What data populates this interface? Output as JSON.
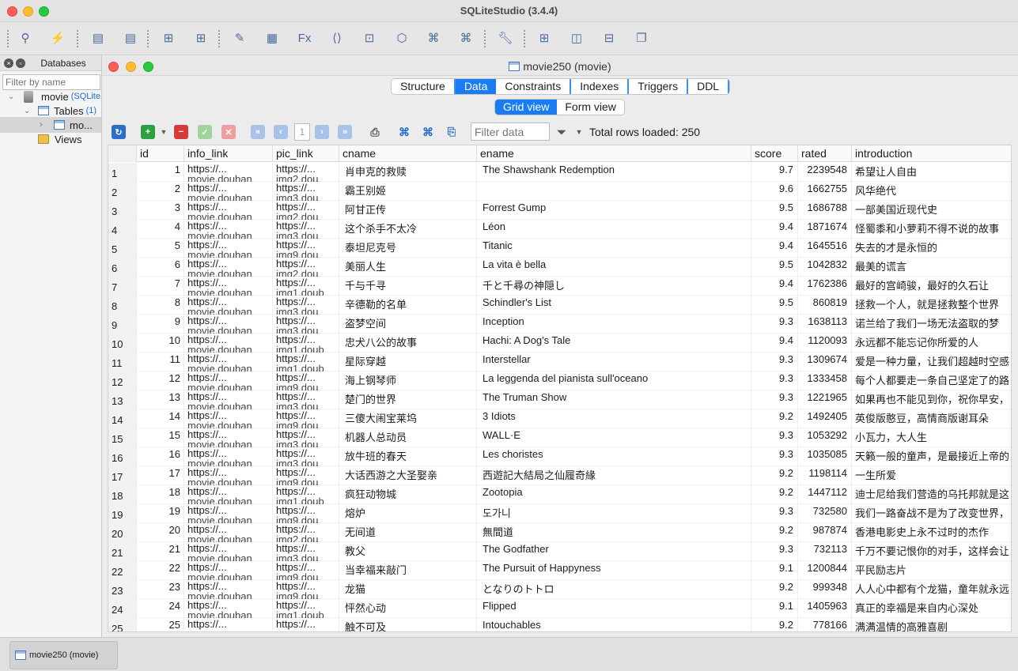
{
  "app": {
    "title": "SQLiteStudio (3.4.4)"
  },
  "toolbar": {
    "icons": [
      "connect-db-icon",
      "disconnect-db-icon",
      "add-database-icon",
      "edit-database-icon",
      "create-table-icon",
      "edit-table-icon",
      "open-sql-editor-icon",
      "sql-functions-icon",
      "ddl-history-icon",
      "collations-icon",
      "extensions-icon",
      "import-icon",
      "export-icon",
      "preferences-icon",
      "tile-windows-icon",
      "tile-horizontal-icon",
      "tile-vertical-icon",
      "cascade-windows-icon"
    ]
  },
  "databases_panel": {
    "title": "Databases",
    "filter_placeholder": "Filter by name",
    "db_name": "movie",
    "db_type": "(SQLite",
    "tables_label": "Tables",
    "tables_count": "(1)",
    "table_item": "mo...",
    "views_label": "Views"
  },
  "window": {
    "title": "movie250 (movie)",
    "tabs": [
      "Structure",
      "Data",
      "Constraints",
      "Indexes",
      "Triggers",
      "DDL"
    ],
    "active_tab": "Data",
    "views": [
      "Grid view",
      "Form view"
    ],
    "active_view": "Grid view"
  },
  "grid_toolbar": {
    "page": "1",
    "filter_placeholder": "Filter data",
    "rows_loaded": "Total rows loaded: 250"
  },
  "grid": {
    "columns": [
      "id",
      "info_link",
      "pic_link",
      "cname",
      "ename",
      "score",
      "rated",
      "introduction"
    ],
    "rows": [
      {
        "n": "1",
        "id": "1",
        "info": "https://...",
        "info2": "movie.douban",
        "pic": "https://...",
        "pic2": "img2.dou",
        "cname": "肖申克的救赎",
        "ename": "The Shawshank Redemption",
        "score": "9.7",
        "rated": "2239548",
        "intro": "希望让人自由"
      },
      {
        "n": "2",
        "id": "2",
        "info": "https://...",
        "info2": "movie.douban",
        "pic": "https://...",
        "pic2": "img3.dou",
        "cname": "霸王别姬",
        "ename": "",
        "score": "9.6",
        "rated": "1662755",
        "intro": "风华绝代"
      },
      {
        "n": "3",
        "id": "3",
        "info": "https://...",
        "info2": "movie.douban",
        "pic": "https://...",
        "pic2": "img2.dou",
        "cname": "阿甘正传",
        "ename": "Forrest Gump",
        "score": "9.5",
        "rated": "1686788",
        "intro": "一部美国近现代史"
      },
      {
        "n": "4",
        "id": "4",
        "info": "https://...",
        "info2": "movie.douban",
        "pic": "https://...",
        "pic2": "img3.dou",
        "cname": "这个杀手不太冷",
        "ename": "Léon",
        "score": "9.4",
        "rated": "1871674",
        "intro": "怪蜀黍和小萝莉不得不说的故事"
      },
      {
        "n": "5",
        "id": "5",
        "info": "https://...",
        "info2": "movie.douban",
        "pic": "https://...",
        "pic2": "img9.dou",
        "cname": "泰坦尼克号",
        "ename": "Titanic",
        "score": "9.4",
        "rated": "1645516",
        "intro": "失去的才是永恒的"
      },
      {
        "n": "6",
        "id": "6",
        "info": "https://...",
        "info2": "movie.douban",
        "pic": "https://...",
        "pic2": "img2.dou",
        "cname": "美丽人生",
        "ename": "La vita è bella",
        "score": "9.5",
        "rated": "1042832",
        "intro": "最美的谎言"
      },
      {
        "n": "7",
        "id": "7",
        "info": "https://...",
        "info2": "movie.douban",
        "pic": "https://...",
        "pic2": "img1.doub",
        "cname": "千与千寻",
        "ename": "千と千尋の神隠し",
        "score": "9.4",
        "rated": "1762386",
        "intro": "最好的宫崎骏，最好的久石让"
      },
      {
        "n": "8",
        "id": "8",
        "info": "https://...",
        "info2": "movie.douban",
        "pic": "https://...",
        "pic2": "img3.dou",
        "cname": "辛德勒的名单",
        "ename": "Schindler's List",
        "score": "9.5",
        "rated": "860819",
        "intro": "拯救一个人，就是拯救整个世界"
      },
      {
        "n": "9",
        "id": "9",
        "info": "https://...",
        "info2": "movie.douban",
        "pic": "https://...",
        "pic2": "img3.dou",
        "cname": "盗梦空间",
        "ename": "Inception",
        "score": "9.3",
        "rated": "1638113",
        "intro": "诺兰给了我们一场无法盗取的梦"
      },
      {
        "n": "10",
        "id": "10",
        "info": "https://...",
        "info2": "movie.douban",
        "pic": "https://...",
        "pic2": "img1.doub",
        "cname": "忠犬八公的故事",
        "ename": "Hachi: A Dog's Tale",
        "score": "9.4",
        "rated": "1120093",
        "intro": "永远都不能忘记你所爱的人"
      },
      {
        "n": "11",
        "id": "11",
        "info": "https://...",
        "info2": "movie.douban",
        "pic": "https://...",
        "pic2": "img1.doub",
        "cname": "星际穿越",
        "ename": "Interstellar",
        "score": "9.3",
        "rated": "1309674",
        "intro": "爱是一种力量，让我们超越时空感"
      },
      {
        "n": "12",
        "id": "12",
        "info": "https://...",
        "info2": "movie.douban",
        "pic": "https://...",
        "pic2": "img9.dou",
        "cname": "海上钢琴师",
        "ename": "La leggenda del pianista sull'oceano",
        "score": "9.3",
        "rated": "1333458",
        "intro": "每个人都要走一条自己坚定了的路"
      },
      {
        "n": "13",
        "id": "13",
        "info": "https://...",
        "info2": "movie.douban",
        "pic": "https://...",
        "pic2": "img3.dou",
        "cname": "楚门的世界",
        "ename": "The Truman Show",
        "score": "9.3",
        "rated": "1221965",
        "intro": "如果再也不能见到你，祝你早安，"
      },
      {
        "n": "14",
        "id": "14",
        "info": "https://...",
        "info2": "movie.douban",
        "pic": "https://...",
        "pic2": "img9.dou",
        "cname": "三傻大闹宝莱坞",
        "ename": "3 Idiots",
        "score": "9.2",
        "rated": "1492405",
        "intro": "英俊版憨豆，高情商版谢耳朵"
      },
      {
        "n": "15",
        "id": "15",
        "info": "https://...",
        "info2": "movie.douban",
        "pic": "https://...",
        "pic2": "img3.dou",
        "cname": "机器人总动员",
        "ename": "WALL·E",
        "score": "9.3",
        "rated": "1053292",
        "intro": "小瓦力，大人生"
      },
      {
        "n": "16",
        "id": "16",
        "info": "https://...",
        "info2": "movie.douban",
        "pic": "https://...",
        "pic2": "img3.dou",
        "cname": "放牛班的春天",
        "ename": "Les choristes",
        "score": "9.3",
        "rated": "1035085",
        "intro": "天籁一般的童声，是最接近上帝的"
      },
      {
        "n": "17",
        "id": "17",
        "info": "https://...",
        "info2": "movie.douban",
        "pic": "https://...",
        "pic2": "img9.dou",
        "cname": "大话西游之大圣娶亲",
        "ename": "西遊記大結局之仙履奇緣",
        "score": "9.2",
        "rated": "1198114",
        "intro": "一生所爱"
      },
      {
        "n": "18",
        "id": "18",
        "info": "https://...",
        "info2": "movie.douban",
        "pic": "https://...",
        "pic2": "img1.doub",
        "cname": "疯狂动物城",
        "ename": "Zootopia",
        "score": "9.2",
        "rated": "1447112",
        "intro": "迪士尼给我们营造的乌托邦就是这"
      },
      {
        "n": "19",
        "id": "19",
        "info": "https://...",
        "info2": "movie.douban",
        "pic": "https://...",
        "pic2": "img9.dou",
        "cname": "熔炉",
        "ename": "도가니",
        "score": "9.3",
        "rated": "732580",
        "intro": "我们一路奋战不是为了改变世界，"
      },
      {
        "n": "20",
        "id": "20",
        "info": "https://...",
        "info2": "movie.douban",
        "pic": "https://...",
        "pic2": "img2.dou",
        "cname": "无间道",
        "ename": "無間道",
        "score": "9.2",
        "rated": "987874",
        "intro": "香港电影史上永不过时的杰作"
      },
      {
        "n": "21",
        "id": "21",
        "info": "https://...",
        "info2": "movie.douban",
        "pic": "https://...",
        "pic2": "img3.dou",
        "cname": "教父",
        "ename": "The Godfather",
        "score": "9.3",
        "rated": "732113",
        "intro": "千万不要记恨你的对手，这样会让"
      },
      {
        "n": "22",
        "id": "22",
        "info": "https://...",
        "info2": "movie.douban",
        "pic": "https://...",
        "pic2": "img9.dou",
        "cname": "当幸福来敲门",
        "ename": "The Pursuit of Happyness",
        "score": "9.1",
        "rated": "1200844",
        "intro": "平民励志片"
      },
      {
        "n": "23",
        "id": "23",
        "info": "https://...",
        "info2": "movie.douban",
        "pic": "https://...",
        "pic2": "img9.dou",
        "cname": "龙猫",
        "ename": "となりのトトロ",
        "score": "9.2",
        "rated": "999348",
        "intro": "人人心中都有个龙猫，童年就永远"
      },
      {
        "n": "24",
        "id": "24",
        "info": "https://...",
        "info2": "movie.douban",
        "pic": "https://...",
        "pic2": "img1.doub",
        "cname": "怦然心动",
        "ename": "Flipped",
        "score": "9.1",
        "rated": "1405963",
        "intro": "真正的幸福是来自内心深处"
      },
      {
        "n": "25",
        "id": "25",
        "info": "https://...",
        "info2": "",
        "pic": "https://...",
        "pic2": "",
        "cname": "触不可及",
        "ename": "Intouchables",
        "score": "9.2",
        "rated": "778166",
        "intro": "满满温情的高雅喜剧"
      }
    ]
  },
  "taskbar": {
    "item": "movie250 (movie)"
  }
}
